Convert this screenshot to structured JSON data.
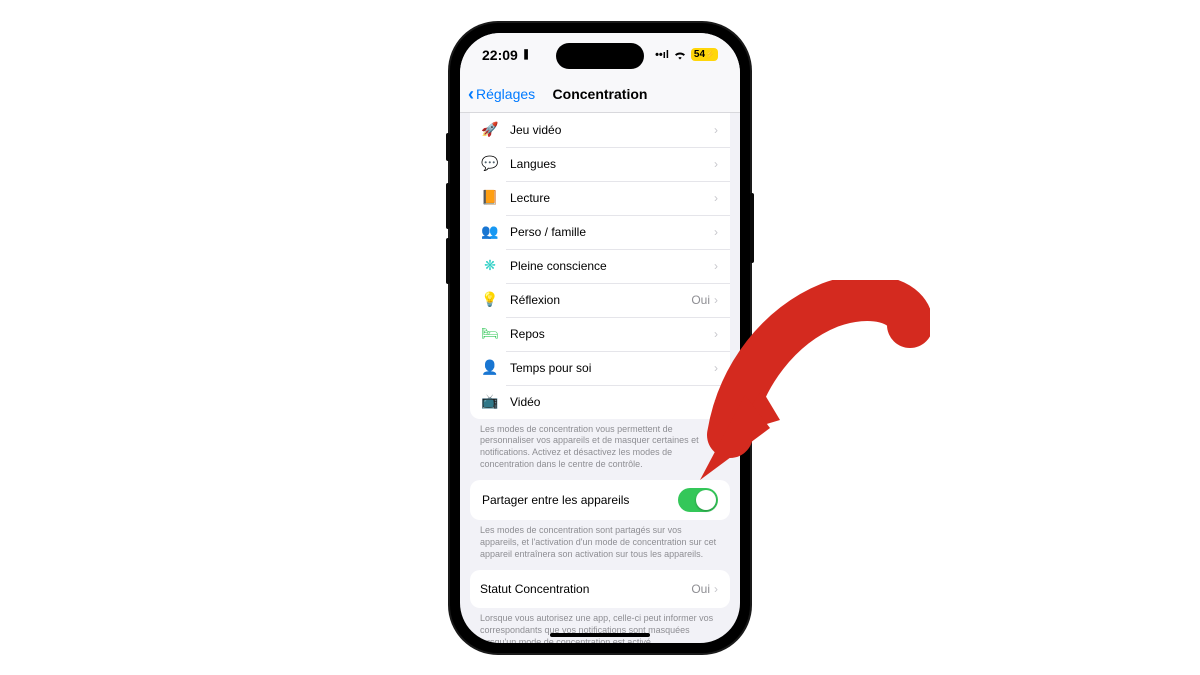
{
  "status": {
    "time": "22:09",
    "battery_text": "54"
  },
  "nav": {
    "back_label": "Réglages",
    "title": "Concentration"
  },
  "focus_modes": [
    {
      "icon": "🚀",
      "icon_class": "ic-rocket",
      "name": "rocket-icon",
      "label": "Jeu vidéo",
      "value": ""
    },
    {
      "icon": "💬",
      "icon_class": "ic-chat",
      "name": "speech-bubble-icon",
      "label": "Langues",
      "value": ""
    },
    {
      "icon": "📙",
      "icon_class": "ic-book",
      "name": "book-icon",
      "label": "Lecture",
      "value": ""
    },
    {
      "icon": "👥",
      "icon_class": "ic-people",
      "name": "people-icon",
      "label": "Perso / famille",
      "value": ""
    },
    {
      "icon": "❋",
      "icon_class": "ic-mind",
      "name": "mindfulness-icon",
      "label": "Pleine conscience",
      "value": ""
    },
    {
      "icon": "💡",
      "icon_class": "ic-bulb",
      "name": "lightbulb-icon",
      "label": "Réflexion",
      "value": "Oui"
    },
    {
      "icon": "🛏",
      "icon_class": "ic-bed",
      "name": "bed-icon",
      "label": "Repos",
      "value": ""
    },
    {
      "icon": "👤",
      "icon_class": "ic-person",
      "name": "person-icon",
      "label": "Temps pour soi",
      "value": ""
    },
    {
      "icon": "📺",
      "icon_class": "ic-tv",
      "name": "tv-icon",
      "label": "Vidéo",
      "value": ""
    }
  ],
  "footer1": "Les modes de concentration vous permettent de personnaliser vos appareils et de masquer certaines et notifications. Activez et désactivez les modes de concentration dans le centre de contrôle.",
  "share_row": {
    "label": "Partager entre les appareils",
    "state": "on"
  },
  "footer2": "Les modes de concentration sont partagés sur vos appareils, et l'activation d'un mode de concentration sur cet appareil entraînera son activation sur tous les appareils.",
  "status_row": {
    "label": "Statut Concentration",
    "value": "Oui"
  },
  "footer3": "Lorsque vous autorisez une app, celle-ci peut informer vos correspondants que vos notifications sont masquées lorsqu'un mode de concentration est activé.",
  "annotation": {
    "arrow_color": "#d42a1f"
  }
}
